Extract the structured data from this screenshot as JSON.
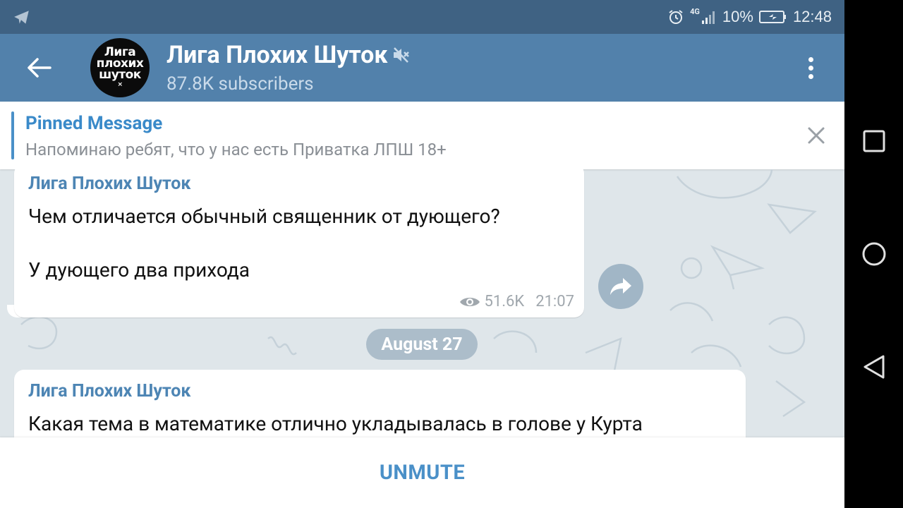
{
  "status_bar": {
    "network": "4G",
    "battery": "10%",
    "time": "12:48"
  },
  "header": {
    "back_icon": "arrow-left-icon",
    "avatar_text": [
      "Лига",
      "плохих",
      "шуток",
      "×"
    ],
    "title": "Лига Плохих Шуток",
    "muted_icon": "muted-speaker-icon",
    "subtitle": "87.8K subscribers",
    "menu_icon": "more-vertical-icon"
  },
  "pinned": {
    "title": "Pinned Message",
    "text": "Напоминаю ребят, что у нас есть Приватка ЛПШ 18+",
    "close_icon": "close-icon"
  },
  "messages": [
    {
      "author": "Лига Плохих Шуток",
      "lines": [
        "Чем отличается обычный священник от дующего?",
        "У дующего два прихода"
      ],
      "views": "51.6K",
      "time": "21:07"
    },
    {
      "author": "Лига Плохих Шуток",
      "lines": [
        "Какая тема в математике отлично укладывалась в голове у Курта"
      ]
    }
  ],
  "date_separator": "August 27",
  "bottom": {
    "unmute_label": "UNMUTE"
  },
  "colors": {
    "header": "#5281ab",
    "status_bar": "#3f6283",
    "accent": "#4a90c8",
    "chat_bg": "#dfe6ea"
  }
}
